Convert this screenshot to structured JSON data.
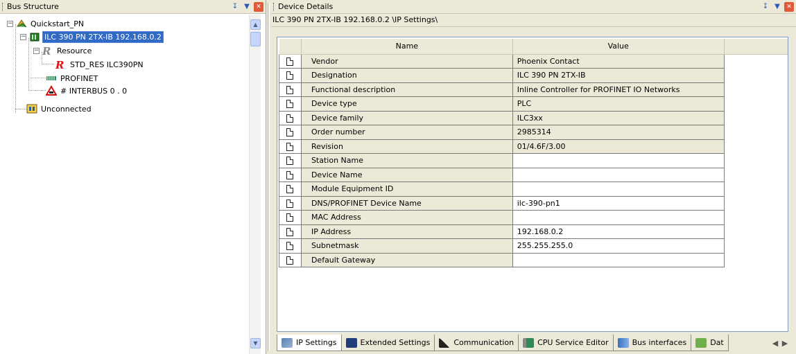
{
  "left_pane": {
    "title": "Bus Structure",
    "tree": [
      {
        "label": "Quickstart_PN",
        "icon": "project-icon"
      },
      {
        "label": "ILC 390 PN 2TX-IB 192.168.0.2",
        "icon": "controller-icon",
        "selected": true
      },
      {
        "label": "Resource",
        "icon": "resource-icon"
      },
      {
        "label": "STD_RES ILC390PN",
        "icon": "std-resource-icon"
      },
      {
        "label": "PROFINET",
        "icon": "profinet-icon"
      },
      {
        "label": "# INTERBUS 0 . 0",
        "icon": "interbus-icon"
      },
      {
        "label": "Unconnected",
        "icon": "unconnected-icon"
      }
    ]
  },
  "right_pane": {
    "title": "Device Details",
    "path": "ILC 390 PN 2TX-IB 192.168.0.2 \\IP Settings\\",
    "columns": [
      "Name",
      "Value"
    ],
    "rows": [
      {
        "name": "Vendor",
        "value": "Phoenix Contact",
        "editable": false
      },
      {
        "name": "Designation",
        "value": "ILC 390 PN 2TX-IB",
        "editable": false
      },
      {
        "name": "Functional description",
        "value": "Inline Controller for PROFINET IO Networks",
        "editable": false
      },
      {
        "name": "Device type",
        "value": "PLC",
        "editable": false
      },
      {
        "name": "Device family",
        "value": "ILC3xx",
        "editable": false
      },
      {
        "name": "Order number",
        "value": "2985314",
        "editable": false
      },
      {
        "name": "Revision",
        "value": "01/4.6F/3.00",
        "editable": false
      },
      {
        "name": "Station Name",
        "value": "",
        "editable": true
      },
      {
        "name": "Device Name",
        "value": "",
        "editable": true
      },
      {
        "name": "Module Equipment ID",
        "value": "",
        "editable": true
      },
      {
        "name": "DNS/PROFINET Device Name",
        "value": "ilc-390-pn1",
        "editable": true
      },
      {
        "name": "MAC Address",
        "value": "",
        "editable": true
      },
      {
        "name": "IP Address",
        "value": "192.168.0.2",
        "editable": true
      },
      {
        "name": "Subnetmask",
        "value": "255.255.255.0",
        "editable": true
      },
      {
        "name": "Default Gateway",
        "value": "",
        "editable": true
      }
    ],
    "tabs": [
      {
        "label": "IP Settings",
        "icon": "network-icon",
        "active": true
      },
      {
        "label": "Extended Settings",
        "icon": "extended-settings-icon"
      },
      {
        "label": "Communication",
        "icon": "communication-icon"
      },
      {
        "label": "CPU Service Editor",
        "icon": "cpu-service-icon"
      },
      {
        "label": "Bus interfaces",
        "icon": "bus-interfaces-icon"
      },
      {
        "label": "Dat",
        "icon": "data-icon"
      }
    ]
  },
  "colors": {
    "selection": "#316ac5",
    "panel": "#ece9d8",
    "grid_border": "#7a7a7a"
  }
}
